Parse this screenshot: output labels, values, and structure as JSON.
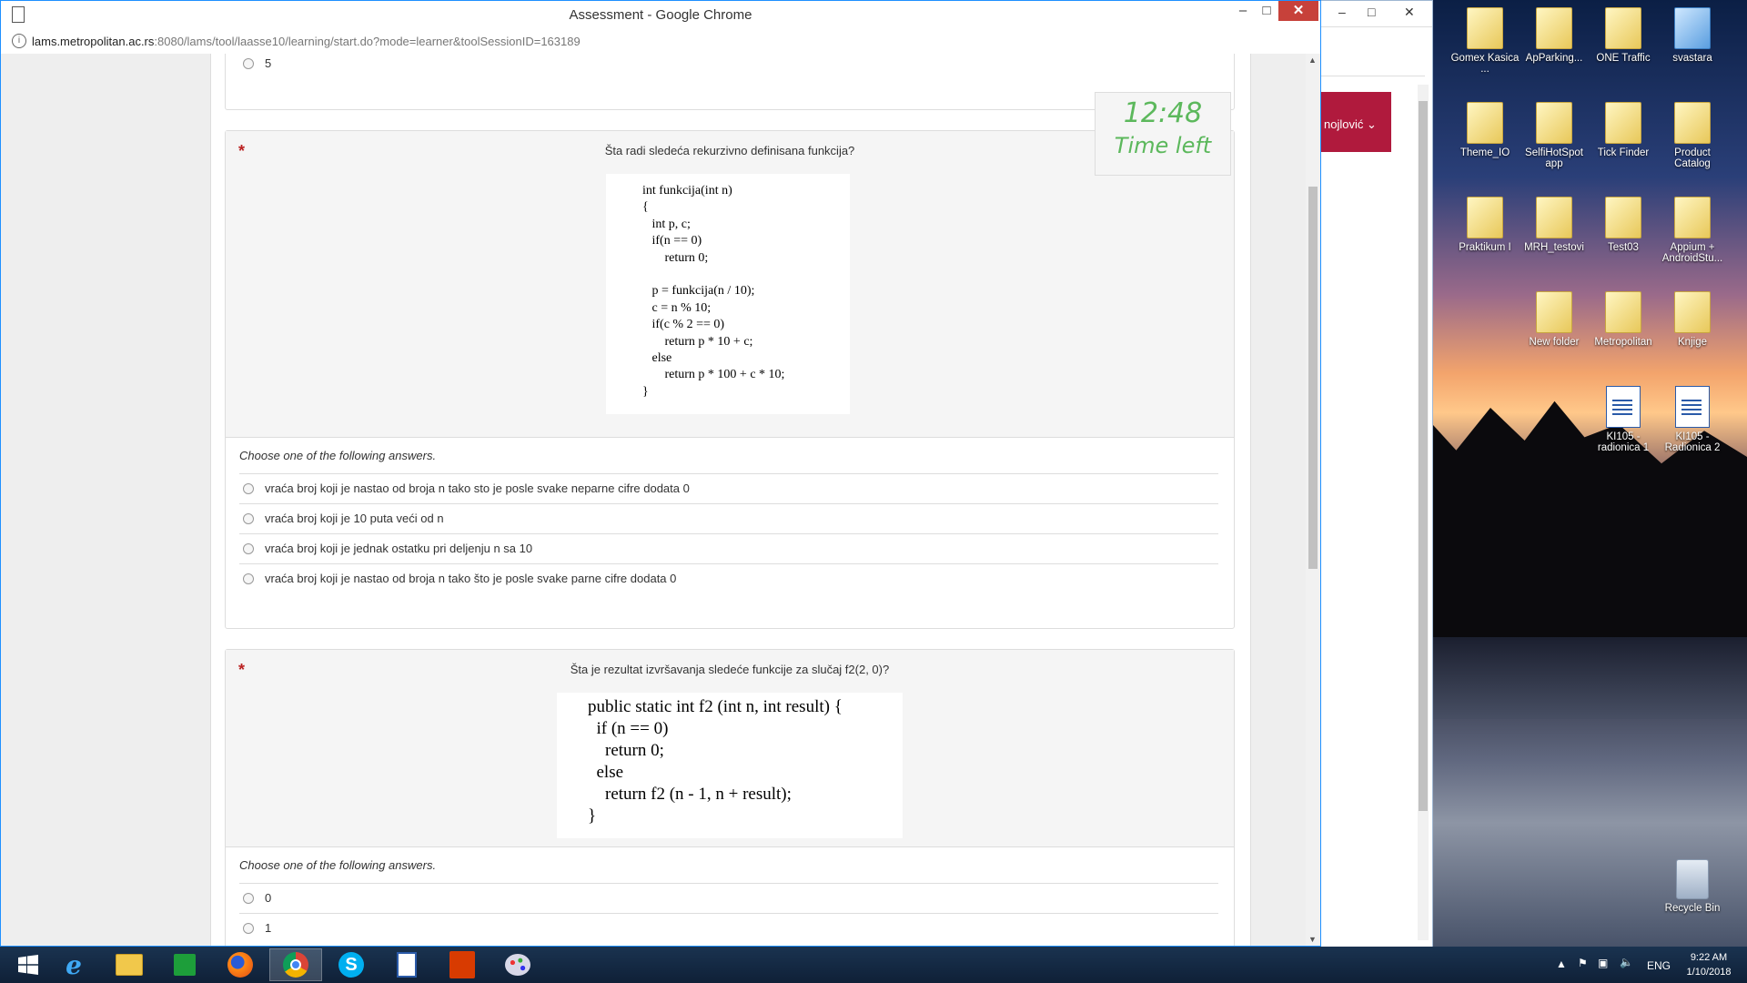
{
  "window": {
    "title": "Assessment - Google Chrome",
    "url_host": "lams.metropolitan.ac.rs",
    "url_rest": ":8080/lams/tool/laasse10/learning/start.do?mode=learner&toolSessionID=163189",
    "minimize": "–",
    "maximize": "□",
    "close": "✕"
  },
  "prev_option": {
    "label": "5"
  },
  "timer": {
    "time": "12:48",
    "label": "Time left"
  },
  "question1": {
    "text": "Šta radi sledeća rekurzivno definisana funkcija?",
    "code": "int funkcija(int n)\n{\n   int p, c;\n   if(n == 0)\n       return 0;\n\n   p = funkcija(n / 10);\n   c = n % 10;\n   if(c % 2 == 0)\n       return p * 10 + c;\n   else\n       return p * 100 + c * 10;\n}",
    "choose": "Choose one of the following answers.",
    "options": [
      "vraća broj koji je nastao od broja n tako sto je posle svake neparne cifre dodata 0",
      "vraća broj koji je 10 puta veći od n",
      "vraća broj koji je jednak ostatku pri deljenju n sa 10",
      "vraća broj koji je nastao od broja n tako što je posle svake parne cifre dodata 0"
    ]
  },
  "question2": {
    "text": "Šta je rezultat izvršavanja sledeće funkcije za slučaj f2(2, 0)?",
    "code": "public static int f2 (int n, int result) {\n  if (n == 0)\n    return 0;\n  else\n    return f2 (n - 1, n + result);\n}",
    "choose": "Choose one of the following answers.",
    "options": [
      "0",
      "1"
    ]
  },
  "background_window": {
    "user_fragment": "nojlović ⌄"
  },
  "desktop_icons": [
    "Gomex Kasica ...",
    "ApParking...",
    "ONE Traffic",
    "svastara",
    "Theme_IO",
    "SelfiHotSpot app",
    "Tick Finder",
    "Product Catalog",
    "Praktikum I",
    "MRH_testovi",
    "Test03",
    "Appium + AndroidStu...",
    "New folder",
    "Metropolitan",
    "Knjige",
    "KI105 - radionica 1",
    "KI105 - Radionica 2",
    "Recycle Bin"
  ],
  "taskbar": {
    "lang": "ENG",
    "time": "9:22 AM",
    "date": "1/10/2018"
  }
}
